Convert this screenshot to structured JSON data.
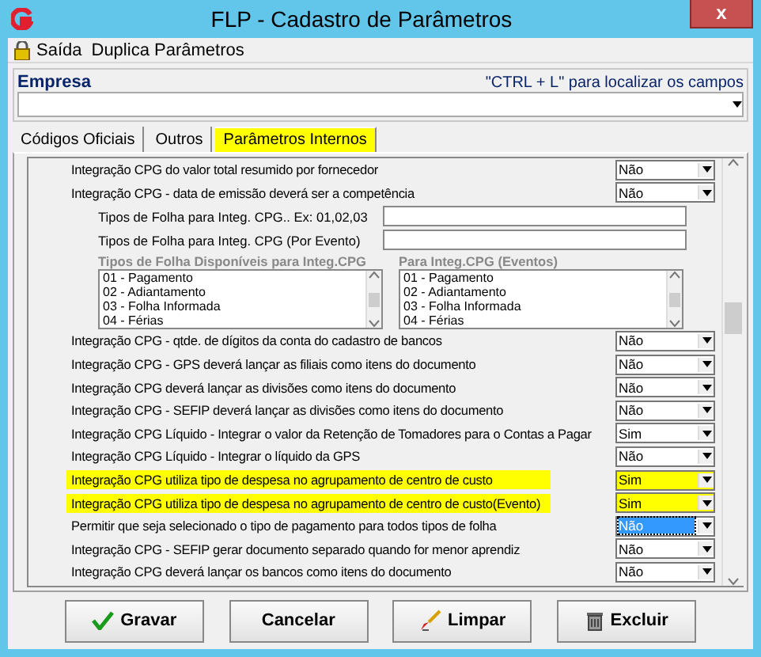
{
  "window": {
    "title": "FLP - Cadastro de Parâmetros",
    "close_label": "x"
  },
  "menu": [
    {
      "label": "Saída",
      "kind": "lock"
    },
    {
      "label": "Duplica Parâmetros",
      "kind": "plain"
    }
  ],
  "company": {
    "label": "Empresa",
    "hint": "\"CTRL + L\" para localizar os campos"
  },
  "tabs": [
    {
      "label": "Códigos Oficiais",
      "selected": false
    },
    {
      "label": "Outros",
      "selected": false
    },
    {
      "label": "Parâmetros Internos",
      "selected": true
    }
  ],
  "settings": [
    {
      "kind": "select",
      "label": "Integração CPG do valor total resumido por fornecedor",
      "value": "Não",
      "highlighted": false,
      "focused": false
    },
    {
      "kind": "select",
      "label": "Integração CPG - data de emissão deverá ser a competência",
      "value": "Não",
      "highlighted": false,
      "focused": false
    },
    {
      "kind": "text",
      "label": "Tipos de Folha para Integ. CPG.. Ex: 01,02,03"
    },
    {
      "kind": "text",
      "label": "Tipos de Folha para Integ. CPG (Por Evento)"
    },
    {
      "kind": "lists",
      "lists": [
        {
          "title": "Tipos de Folha Disponíveis para Integ.CPG",
          "items": [
            "01 - Pagamento",
            "02 - Adiantamento",
            "03 - Folha Informada",
            "04 - Férias"
          ]
        },
        {
          "title": "Para Integ.CPG (Eventos)",
          "items": [
            "01 - Pagamento",
            "02 - Adiantamento",
            "03 - Folha Informada",
            "04 - Férias"
          ]
        }
      ]
    },
    {
      "kind": "select",
      "label": "Integração CPG - qtde. de dígitos da conta do cadastro de bancos",
      "value": "Não",
      "highlighted": false,
      "focused": false
    },
    {
      "kind": "select",
      "label": "Integração CPG - GPS deverá lançar as filiais como itens do documento",
      "value": "Não",
      "highlighted": false,
      "focused": false
    },
    {
      "kind": "select",
      "label": "Integração CPG deverá lançar as divisões como itens do documento",
      "value": "Não",
      "highlighted": false,
      "focused": false
    },
    {
      "kind": "select",
      "label": "Integração CPG - SEFIP deverá lançar as divisões como itens do documento",
      "value": "Não",
      "highlighted": false,
      "focused": false
    },
    {
      "kind": "select",
      "label": "Integração CPG Líquido - Integrar o valor da Retenção de Tomadores para o Contas a Pagar",
      "value": "Sim",
      "highlighted": false,
      "focused": false
    },
    {
      "kind": "select",
      "label": "Integração CPG Líquido - Integrar o líquido da GPS",
      "value": "Não",
      "highlighted": false,
      "focused": false
    },
    {
      "kind": "select",
      "label": "Integração CPG utiliza tipo de despesa no agrupamento de centro de custo",
      "value": "Sim",
      "highlighted": true,
      "focused": false
    },
    {
      "kind": "select",
      "label": "Integração CPG utiliza tipo de despesa no agrupamento de centro de custo(Evento)",
      "value": "Sim",
      "highlighted": true,
      "focused": false
    },
    {
      "kind": "select",
      "label": "Permitir que seja selecionado o tipo de pagamento para todos tipos de folha",
      "value": "Não",
      "highlighted": false,
      "focused": true
    },
    {
      "kind": "select",
      "label": "Integração CPG - SEFIP gerar documento separado quando for menor aprendiz",
      "value": "Não",
      "highlighted": false,
      "focused": false
    },
    {
      "kind": "select",
      "label": "Integração CPG deverá lançar os bancos como itens do documento",
      "value": "Não",
      "highlighted": false,
      "focused": false
    }
  ],
  "buttons": [
    {
      "label": "Gravar",
      "kind": "check"
    },
    {
      "label": "Cancelar",
      "kind": "none"
    },
    {
      "label": "Limpar",
      "kind": "brush"
    },
    {
      "label": "Excluir",
      "kind": "trash"
    }
  ]
}
